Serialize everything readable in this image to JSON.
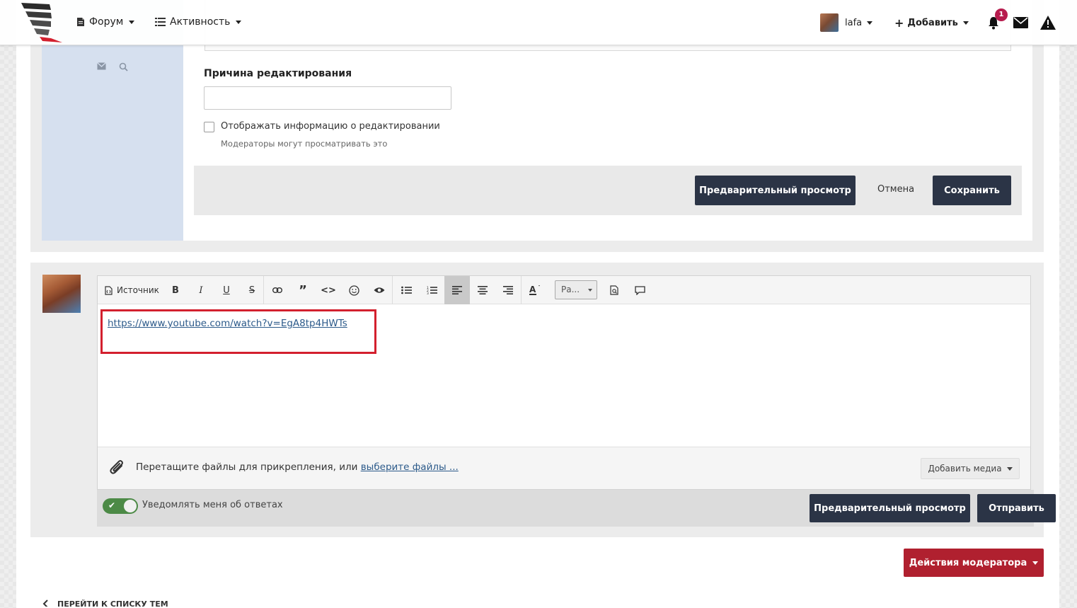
{
  "nav": {
    "forum_label": "Форум",
    "activity_label": "Активность",
    "username": "lafa",
    "add_label": "Добавить",
    "notifications_count": "1"
  },
  "edit": {
    "reason_label": "Причина редактирования",
    "reason_value": "",
    "show_edit_info_label": "Отображать информацию о редактировании",
    "moderators_hint": "Модераторы могут просматривать это",
    "preview_label": "Предварительный просмотр",
    "cancel_label": "Отмена",
    "save_label": "Сохранить"
  },
  "editor": {
    "source_label": "Источник",
    "font_size_value": "Ра...",
    "content_link": "https://www.youtube.com/watch?v=EgA8tp4HWTs",
    "attach_text": "Перетащите файлы для прикрепления, или ",
    "attach_link": "выберите файлы ...",
    "add_media_label": "Добавить медиа",
    "highlight_color": "#d3202e"
  },
  "reply": {
    "notify_label": "Уведомлять меня об ответах",
    "notify_enabled": true,
    "preview_label": "Предварительный просмотр",
    "submit_label": "Отправить"
  },
  "moderator_actions_label": "Действия модератора",
  "back_to_list_label": "ПЕРЕЙТИ К СПИСКУ ТЕМ",
  "colors": {
    "dark_button": "#2b3446",
    "moderator_button": "#b0202f",
    "user_column": "#d6e0ef",
    "toggle_on": "#4c8a46",
    "badge": "#b71c4e"
  }
}
